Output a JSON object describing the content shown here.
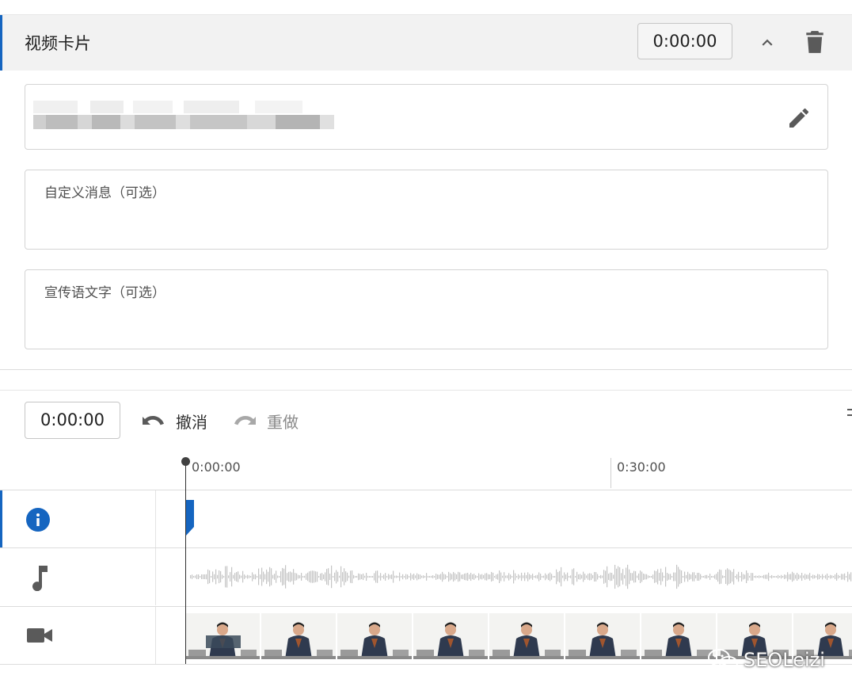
{
  "card": {
    "title": "视频卡片",
    "start_time": "0:00:00",
    "accent_color": "#1565c0"
  },
  "fields": {
    "custom_message_placeholder": "自定义消息（可选）",
    "teaser_placeholder": "宣传语文字（可选）"
  },
  "timeline": {
    "current_time": "0:00:00",
    "undo_label": "撤消",
    "redo_label": "重做",
    "ruler_ticks": [
      "0:00:00",
      "0:30:00"
    ],
    "tracks": [
      {
        "name": "info",
        "icon": "info-icon"
      },
      {
        "name": "audio",
        "icon": "music-note-icon"
      },
      {
        "name": "video",
        "icon": "video-camera-icon"
      }
    ]
  },
  "watermark": {
    "text": "SEOLeizi",
    "icon": "wechat-icon"
  },
  "icons": {
    "collapse": "chevron-up-icon",
    "delete": "trash-icon",
    "edit": "pencil-icon",
    "undo": "undo-arrow-icon",
    "redo": "redo-arrow-icon"
  }
}
